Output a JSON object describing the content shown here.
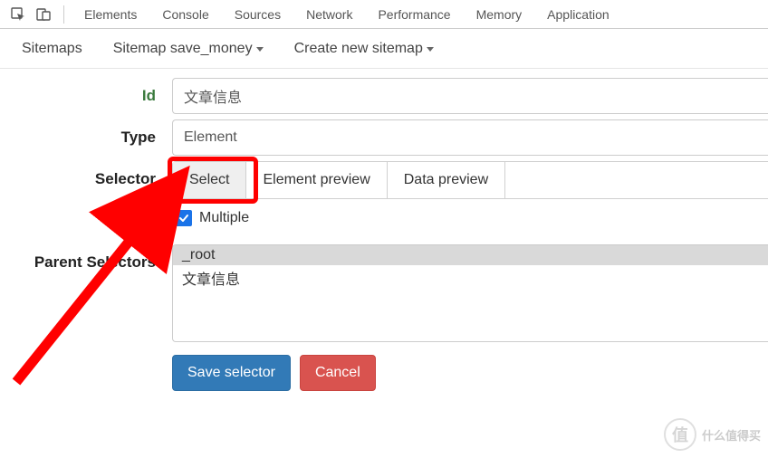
{
  "devtools": {
    "tabs": [
      "Elements",
      "Console",
      "Sources",
      "Network",
      "Performance",
      "Memory",
      "Application"
    ]
  },
  "ws_toolbar": {
    "sitemaps": "Sitemaps",
    "sitemap_current": "Sitemap save_money",
    "create_new": "Create new sitemap"
  },
  "form": {
    "labels": {
      "id": "Id",
      "type": "Type",
      "selector": "Selector",
      "parent_selectors": "Parent Selectors"
    },
    "id_value": "文章信息",
    "type_value": "Element",
    "selector_buttons": {
      "select": "Select",
      "element_preview": "Element preview",
      "data_preview": "Data preview"
    },
    "multiple_label": "Multiple",
    "multiple_checked": true,
    "parent_options": [
      "_root",
      "文章信息"
    ],
    "parent_selected_index": 0
  },
  "actions": {
    "save": "Save selector",
    "cancel": "Cancel"
  },
  "watermark": {
    "glyph": "值",
    "text": "什么值得买"
  }
}
